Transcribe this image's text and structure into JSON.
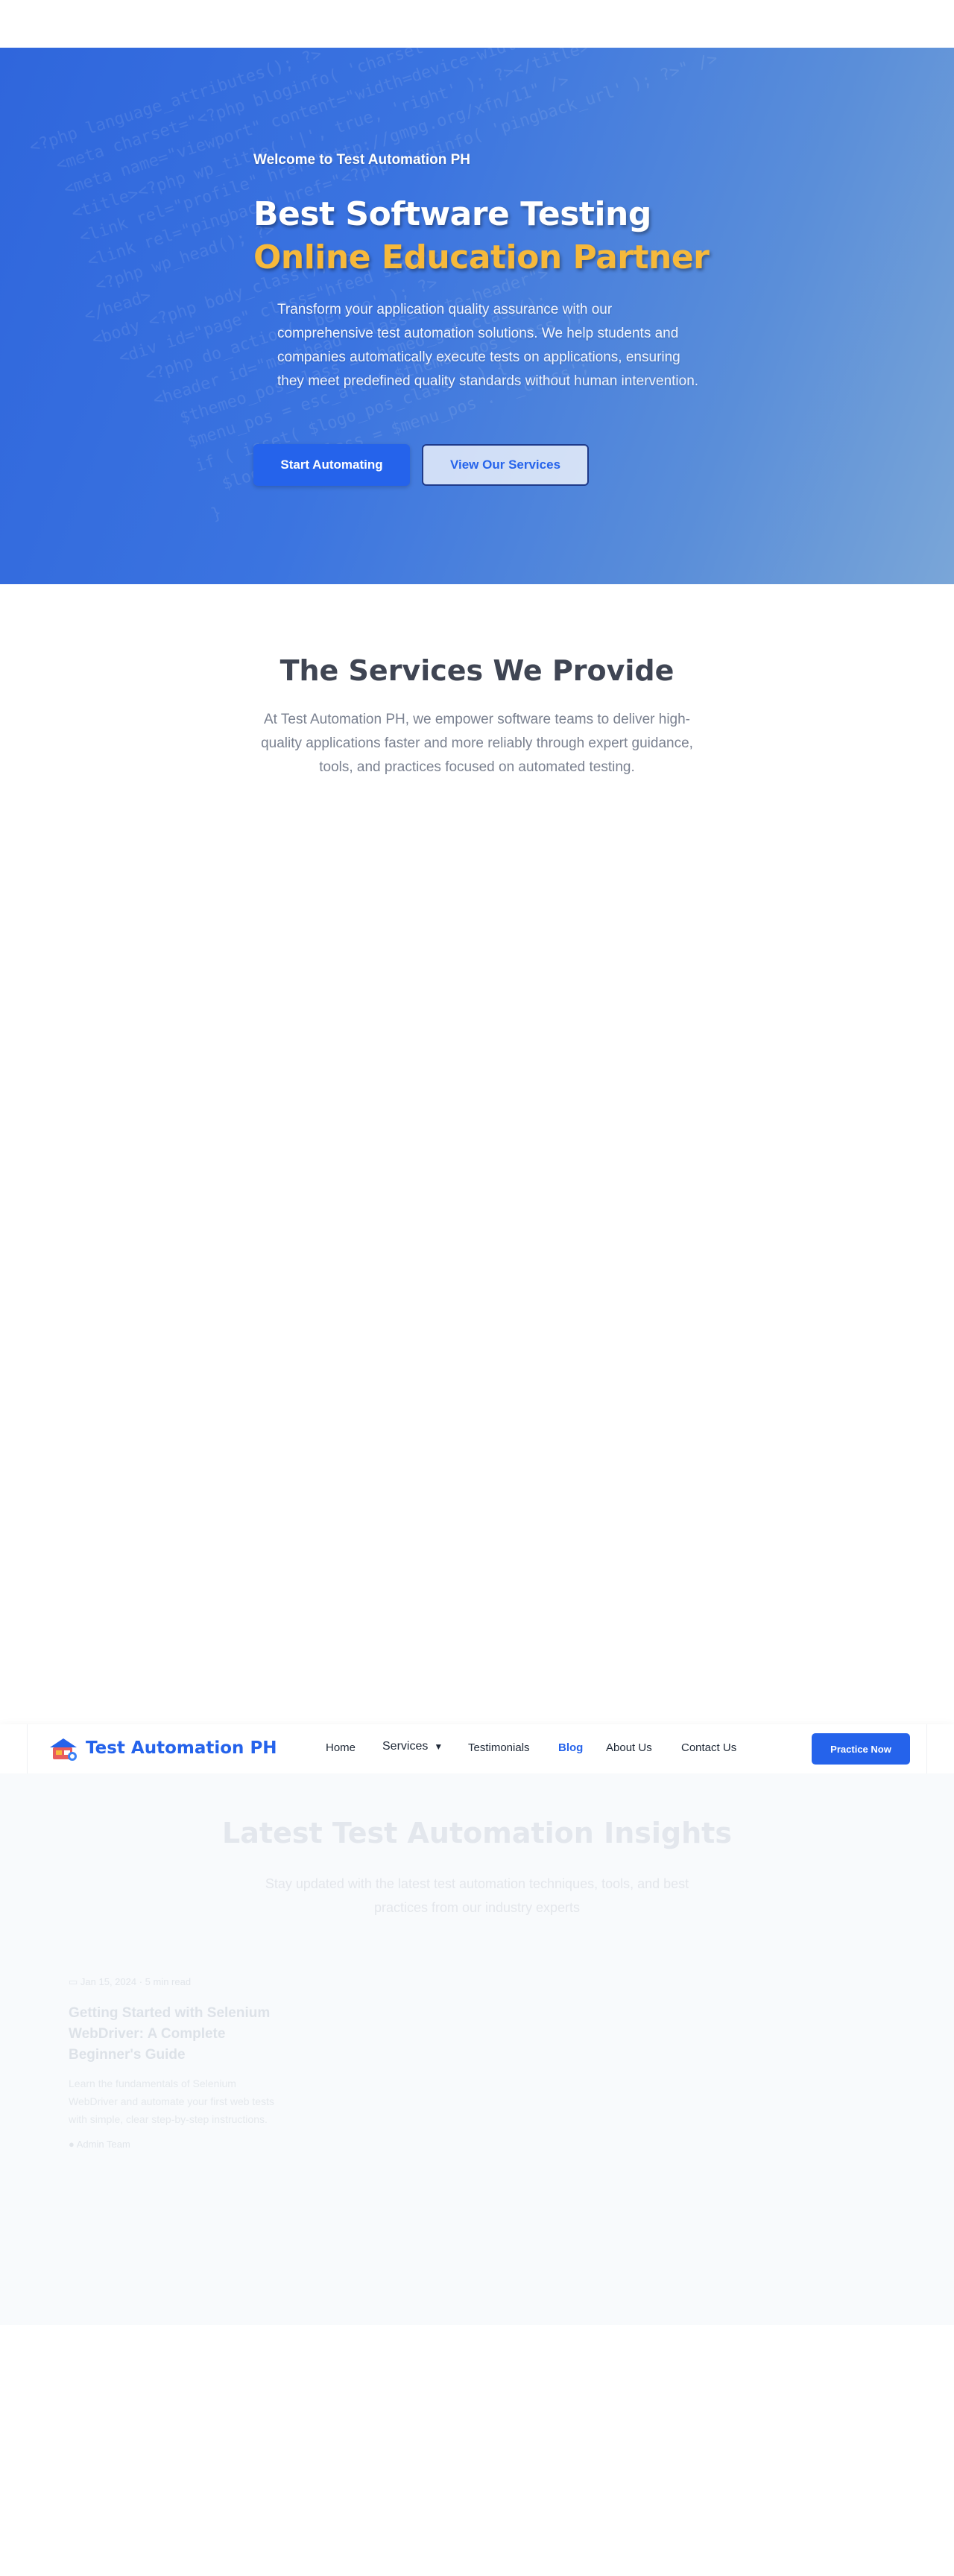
{
  "hero": {
    "welcome": "Welcome to Test Automation PH",
    "title_line1": "Best Software Testing",
    "title_line2": "Online Education Partner",
    "description": "Transform your application quality assurance with our comprehensive test automation solutions. We help students and companies automatically execute tests on applications, ensuring they meet predefined quality standards without human intervention.",
    "primary_button": "Start Automating",
    "secondary_button": "View Our Services"
  },
  "services": {
    "title": "The Services We Provide",
    "description": "At Test Automation PH, we empower software teams to deliver high-quality applications faster and more reliably through expert guidance, tools, and practices focused on automated testing."
  },
  "navbar": {
    "brand": "Test Automation PH",
    "links": {
      "home": "Home",
      "services": "Services",
      "testimonials": "Testimonials",
      "blog": "Blog",
      "about": "About Us",
      "contact": "Contact Us"
    },
    "cta": "Practice Now",
    "active_link": "Blog"
  },
  "blog": {
    "title": "Latest Test Automation Insights",
    "description": "Stay updated with the latest test automation techniques, tools, and best practices from our industry experts",
    "posts": [
      {
        "date": "Jan 15, 2024 · 5 min read",
        "title": "Getting Started with Selenium WebDriver: A Complete Beginner's Guide",
        "excerpt": "Learn the fundamentals of Selenium WebDriver and automate your first web tests with simple, clear step-by-step instructions.",
        "author": "Admin Team"
      }
    ]
  },
  "colors": {
    "brand": "#2563eb",
    "accent": "#f6b93b",
    "hero_start": "#2f66dc",
    "hero_end": "#7aa6d8"
  },
  "icons": {
    "chevron": "chevron-down-icon",
    "logo": "logo-icon",
    "calendar": "calendar-icon",
    "user": "user-icon"
  }
}
